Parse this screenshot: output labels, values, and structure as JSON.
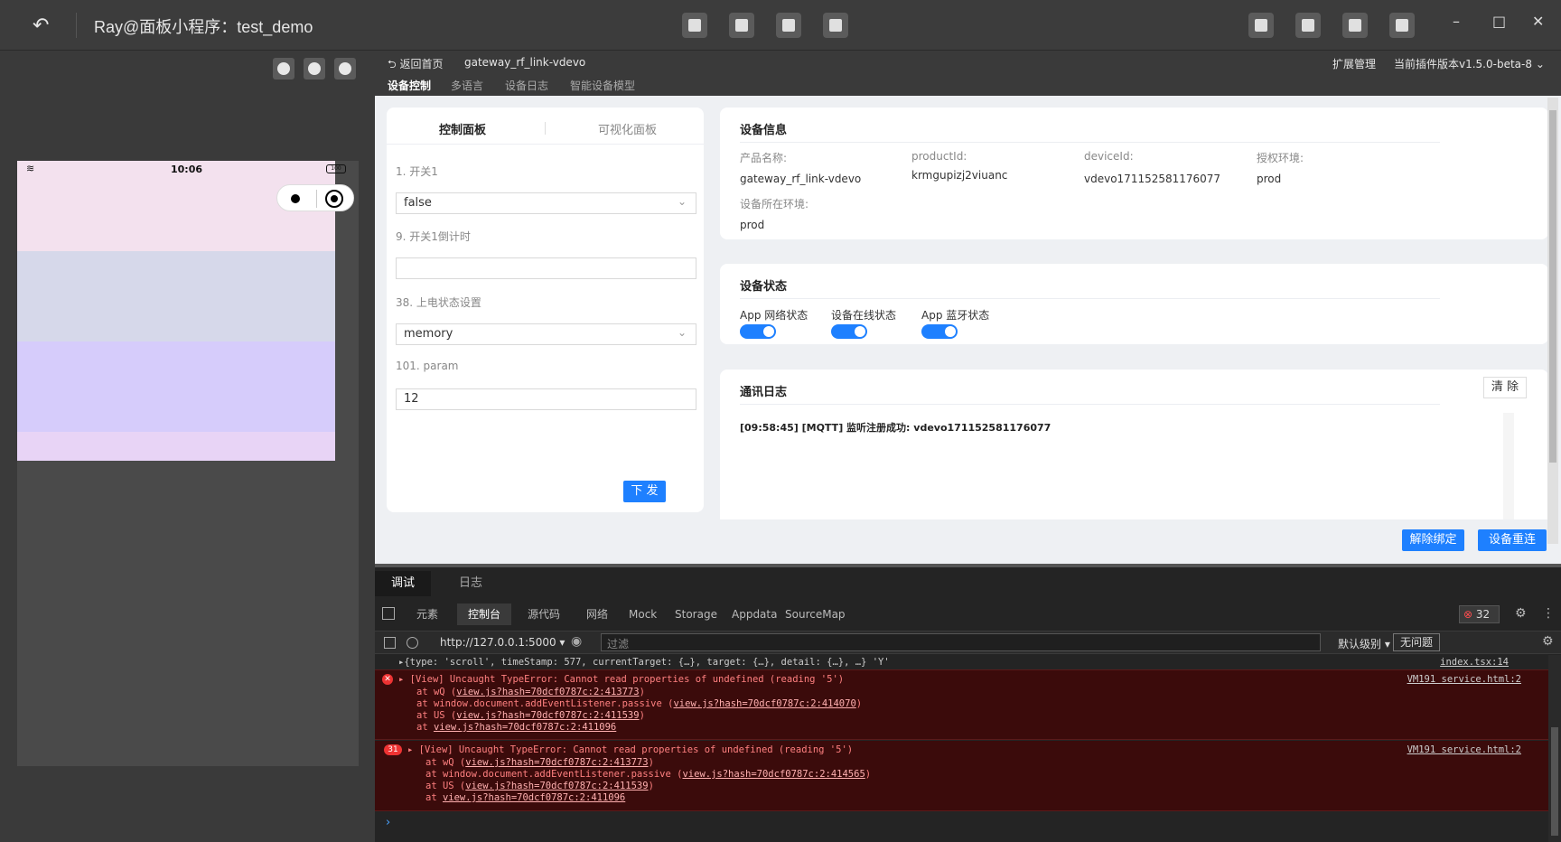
{
  "window": {
    "title": "Ray@面板小程序：test_demo",
    "controls": {
      "minimize": "–",
      "maximize": "□",
      "close": "✕"
    }
  },
  "simulator": {
    "status_time": "10:06",
    "battery": "100"
  },
  "breadcrumb": {
    "back": "返回首页",
    "project": "gateway_rf_link-vdevo",
    "ext_manage": "扩展管理",
    "plugin_version": "当前插件版本v1.5.0-beta-8"
  },
  "top_tabs": [
    "设备控制",
    "多语言",
    "设备日志",
    "智能设备模型"
  ],
  "control_panel": {
    "tabs": [
      "控制面板",
      "可视化面板"
    ],
    "fields": [
      {
        "label": "1. 开关1",
        "value": "false",
        "type": "select"
      },
      {
        "label": "9. 开关1倒计时",
        "value": "",
        "type": "input"
      },
      {
        "label": "38. 上电状态设置",
        "value": "memory",
        "type": "select"
      },
      {
        "label": "101. param",
        "value": "12",
        "type": "input"
      }
    ],
    "send_button": "下 发"
  },
  "device_info": {
    "title": "设备信息",
    "product_name_label": "产品名称:",
    "product_name": "gateway_rf_link-vdevo",
    "product_id_label": "productId:",
    "product_id": "krmgupizj2viuanc",
    "device_id_label": "deviceId:",
    "device_id": "vdevo171152581176077",
    "auth_env_label": "授权环境:",
    "auth_env": "prod",
    "device_env_label": "设备所在环境:",
    "device_env": "prod"
  },
  "device_status": {
    "title": "设备状态",
    "items": [
      "App 网络状态",
      "设备在线状态",
      "App 蓝牙状态"
    ]
  },
  "comm_log": {
    "title": "通讯日志",
    "clear_button": "清 除",
    "entries": [
      "[09:58:45] [MQTT] 监听注册成功: vdevo171152581176077"
    ]
  },
  "actions": {
    "unbind": "解除绑定",
    "reconnect": "设备重连"
  },
  "devtools": {
    "main_tabs": [
      "调试",
      "日志"
    ],
    "panel_tabs": [
      "元素",
      "控制台",
      "源代码",
      "网络",
      "Mock",
      "Storage",
      "Appdata",
      "SourceMap"
    ],
    "error_count": "32",
    "context": "http://127.0.0.1:5000",
    "filter_placeholder": "过滤",
    "level": "默认级别",
    "issues": "无问题",
    "log": {
      "first_line": "{type: 'scroll', timeStamp: 577, currentTarget: {…}, target: {…}, detail: {…}, …} 'Y'",
      "first_src": "index.tsx:14",
      "error1_msg": "[View] Uncaught TypeError: Cannot read properties of undefined (reading '5')",
      "error1_src": "VM191 service.html:2",
      "error1_stack": [
        {
          "prefix": "at wQ (",
          "link": "view.js?hash=70dcf0787c:2:413773",
          "suffix": ")"
        },
        {
          "prefix": "at window.document.addEventListener.passive (",
          "link": "view.js?hash=70dcf0787c:2:414070",
          "suffix": ")"
        },
        {
          "prefix": "at US (",
          "link": "view.js?hash=70dcf0787c:2:411539",
          "suffix": ")"
        },
        {
          "prefix": "at ",
          "link": "view.js?hash=70dcf0787c:2:411096",
          "suffix": ""
        }
      ],
      "error2_count": "31",
      "error2_msg": "[View] Uncaught TypeError: Cannot read properties of undefined (reading '5')",
      "error2_src": "VM191 service.html:2",
      "error2_stack": [
        {
          "prefix": "at wQ (",
          "link": "view.js?hash=70dcf0787c:2:413773",
          "suffix": ")"
        },
        {
          "prefix": "at window.document.addEventListener.passive (",
          "link": "view.js?hash=70dcf0787c:2:414565",
          "suffix": ")"
        },
        {
          "prefix": "at US (",
          "link": "view.js?hash=70dcf0787c:2:411539",
          "suffix": ")"
        },
        {
          "prefix": "at ",
          "link": "view.js?hash=70dcf0787c:2:411096",
          "suffix": ""
        }
      ],
      "prompt": "›"
    }
  }
}
